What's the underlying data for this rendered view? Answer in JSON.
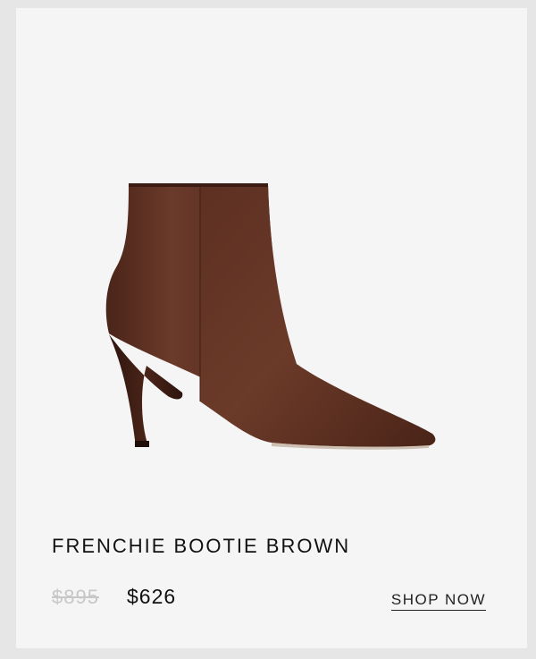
{
  "product": {
    "image_alt": "Frenchie Bootie Brown product photo",
    "name": "FRENCHIE BOOTIE BROWN",
    "original_price": "$895",
    "sale_price": "$626",
    "cta_label": "SHOP NOW"
  },
  "colors": {
    "page_background": "#e6e6e6",
    "card_background": "#f5f5f5",
    "boot_leather": "#5a2e22",
    "text_primary": "#111111",
    "text_strikethrough": "#c7c7c7"
  }
}
